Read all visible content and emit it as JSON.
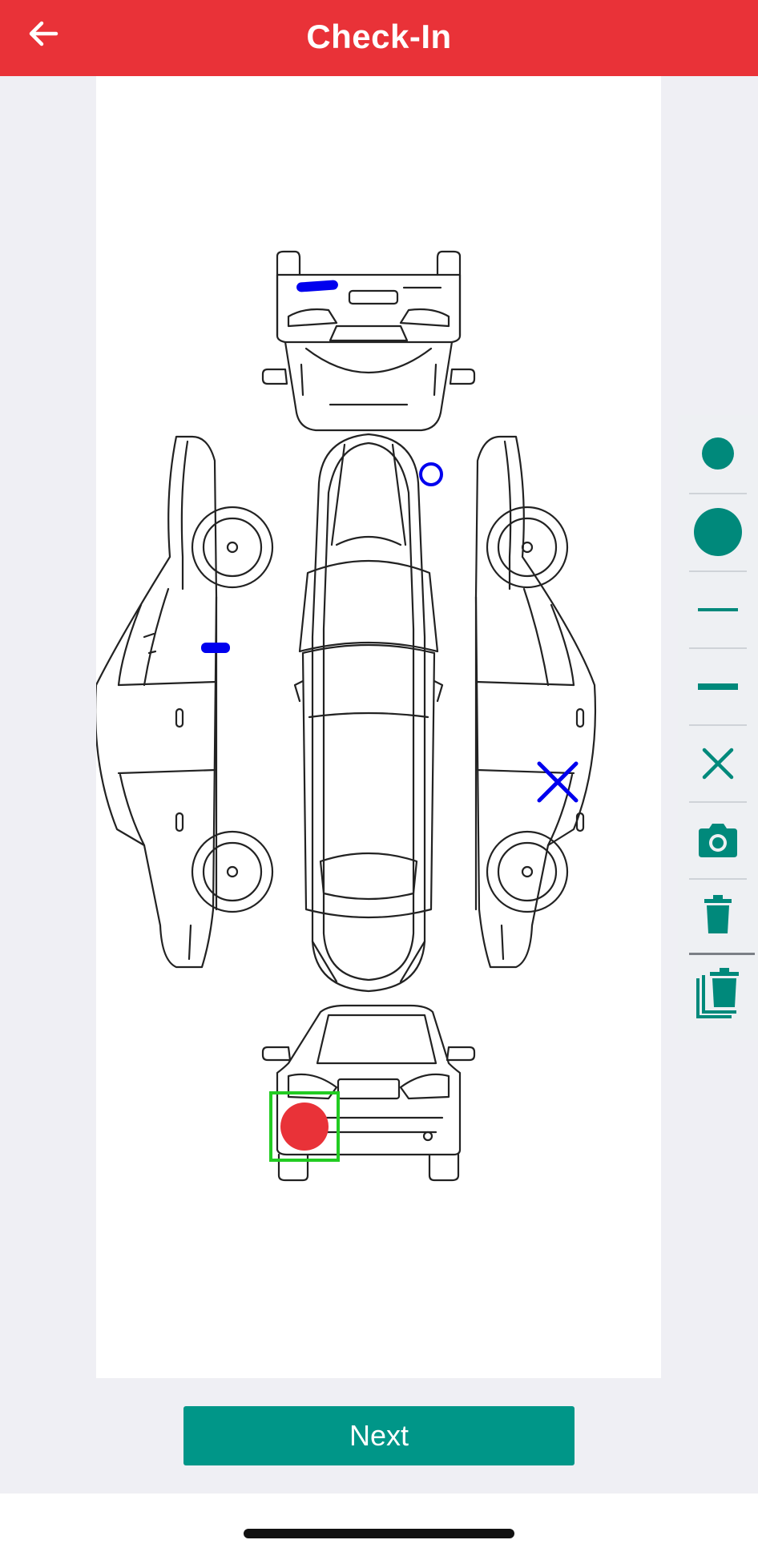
{
  "header": {
    "title": "Check-In",
    "back_icon": "arrow-left-icon",
    "background_color": "#e93238"
  },
  "diagram": {
    "subject": "car-outline",
    "views": [
      "top",
      "left-side",
      "right-side",
      "front",
      "rear"
    ],
    "marks": [
      {
        "kind": "line",
        "color": "#0000ee",
        "view": "front"
      },
      {
        "kind": "circle-outline",
        "color": "#0000ee",
        "view": "top"
      },
      {
        "kind": "line",
        "color": "#0000ee",
        "view": "left-side"
      },
      {
        "kind": "cross",
        "color": "#0000ee",
        "view": "right-side"
      },
      {
        "kind": "filled-circle",
        "color": "#e93238",
        "view": "rear",
        "selected": true
      }
    ],
    "selection_color": "#22cc22"
  },
  "toolbar": {
    "accent_color": "#00897b",
    "tools": [
      {
        "name": "small-dot-tool",
        "icon": "small-dot-icon"
      },
      {
        "name": "large-dot-tool",
        "icon": "large-dot-icon"
      },
      {
        "name": "thin-line-tool",
        "icon": "thin-line-icon"
      },
      {
        "name": "thick-line-tool",
        "icon": "thick-line-icon"
      },
      {
        "name": "cross-tool",
        "icon": "close-icon"
      },
      {
        "name": "camera-tool",
        "icon": "camera-icon"
      },
      {
        "name": "delete-tool",
        "icon": "trash-icon"
      },
      {
        "name": "delete-all-tool",
        "icon": "trash-stack-icon"
      }
    ]
  },
  "footer": {
    "next_label": "Next",
    "button_color": "#009688"
  }
}
